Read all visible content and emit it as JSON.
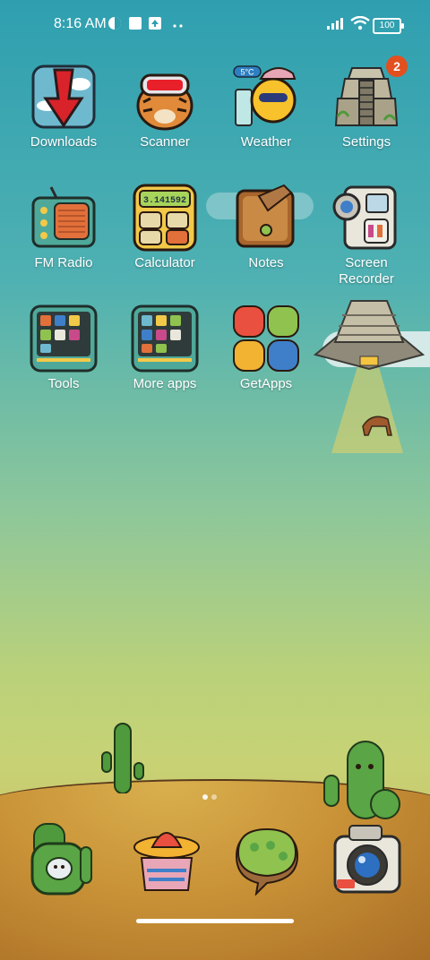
{
  "status_bar": {
    "time": "8:16 AM",
    "battery": "100"
  },
  "apps": [
    {
      "label": "Downloads"
    },
    {
      "label": "Scanner"
    },
    {
      "label": "Weather",
      "weather_temp": "5°C"
    },
    {
      "label": "Settings",
      "badge": "2"
    },
    {
      "label": "FM Radio"
    },
    {
      "label": "Calculator",
      "calc_display": "3.141592"
    },
    {
      "label": "Notes"
    },
    {
      "label": "Screen\nRecorder"
    },
    {
      "label": "Tools"
    },
    {
      "label": "More apps"
    },
    {
      "label": "GetApps"
    }
  ],
  "colors": {
    "badge": "#e2501f",
    "sky_top": "#2f9fb0",
    "sky_bottom": "#c8d275",
    "ground": "#c99237"
  },
  "page_indicator": {
    "pages": 2,
    "current": 1
  }
}
